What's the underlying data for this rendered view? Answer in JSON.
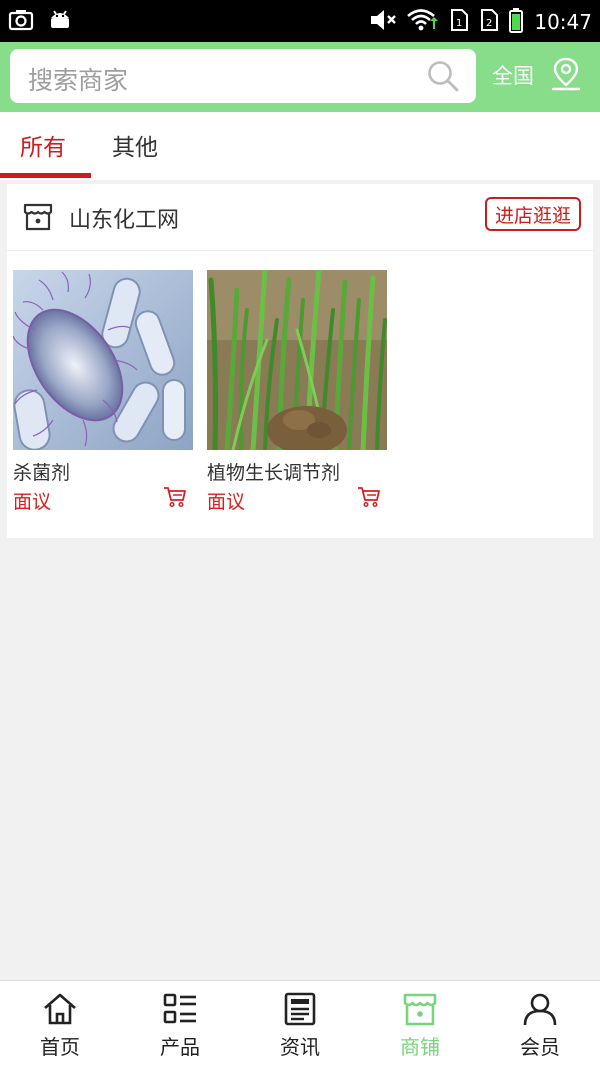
{
  "status_bar": {
    "time": "10:47"
  },
  "header": {
    "search_placeholder": "搜索商家",
    "region_label": "全国"
  },
  "tabs": [
    {
      "label": "所有",
      "active": true
    },
    {
      "label": "其他",
      "active": false
    }
  ],
  "shop": {
    "name": "山东化工网",
    "visit_button": "进店逛逛",
    "products": [
      {
        "name": "杀菌剂",
        "price": "面议",
        "image": "bacteria-microscope-image"
      },
      {
        "name": "植物生长调节剂",
        "price": "面议",
        "image": "green-seedlings-image"
      }
    ]
  },
  "bottom_nav": [
    {
      "label": "首页",
      "icon": "home-icon",
      "active": false
    },
    {
      "label": "产品",
      "icon": "product-list-icon",
      "active": false
    },
    {
      "label": "资讯",
      "icon": "news-icon",
      "active": false
    },
    {
      "label": "商铺",
      "icon": "store-icon",
      "active": true
    },
    {
      "label": "会员",
      "icon": "member-icon",
      "active": false
    }
  ],
  "colors": {
    "accent_green": "#88dd8b",
    "active_red": "#cf1b1b",
    "nav_active": "#7ad37d"
  }
}
